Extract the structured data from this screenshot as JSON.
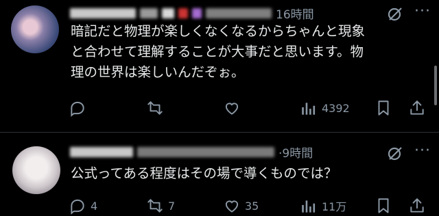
{
  "posts": [
    {
      "time": "16時間",
      "body": "暗記だと物理が楽しくなくなるからちゃんと現象\nと合わせて理解することが大事だと思います。物\n理の世界は楽しいんだぞぉ。",
      "replies": "",
      "reposts": "",
      "likes": "",
      "views": "4392"
    },
    {
      "time": "·9時間",
      "body": "公式ってある程度はその場で導くものでは？",
      "replies": "4",
      "reposts": "7",
      "likes": "35",
      "views": "11万"
    }
  ],
  "icons": {
    "reply": "reply-icon",
    "repost": "repost-icon",
    "like": "like-icon",
    "views": "views-icon",
    "bookmark": "bookmark-icon",
    "share": "share-icon",
    "grok": "grok-icon",
    "more": "more-icon"
  },
  "colors": {
    "background": "#000000",
    "text": "#e7e9ea",
    "muted": "#8b98a5",
    "divider": "#2f3336"
  }
}
